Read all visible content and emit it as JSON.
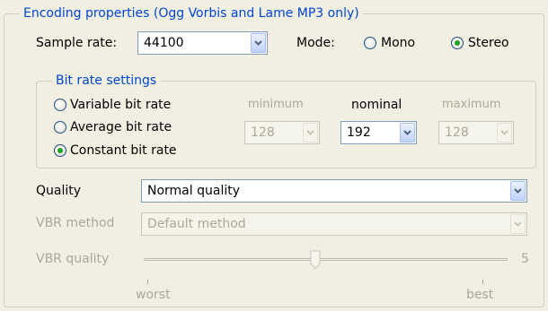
{
  "encoding": {
    "title": "Encoding properties (Ogg Vorbis and Lame MP3 only)",
    "sample_rate_label": "Sample rate:",
    "sample_rate_value": "44100",
    "mode_label": "Mode:",
    "mode_mono": "Mono",
    "mode_stereo": "Stereo",
    "mode_selected": "Stereo"
  },
  "bitrate": {
    "title": "Bit rate settings",
    "variable": "Variable bit rate",
    "average": "Average bit rate",
    "constant": "Constant bit rate",
    "selected": "Constant bit rate",
    "minimum_label": "minimum",
    "nominal_label": "nominal",
    "maximum_label": "maximum",
    "minimum_value": "128",
    "nominal_value": "192",
    "maximum_value": "128"
  },
  "quality": {
    "label": "Quality",
    "value": "Normal quality",
    "vbr_method_label": "VBR method",
    "vbr_method_value": "Default method",
    "vbr_quality_label": "VBR quality",
    "vbr_quality_value": "5",
    "slider_worst": "worst",
    "slider_best": "best",
    "slider_level_fraction": 0.5
  },
  "colors": {
    "group_title": "#0046d5",
    "disabled_text": "#aca899",
    "radio_dot": "#21a121"
  }
}
